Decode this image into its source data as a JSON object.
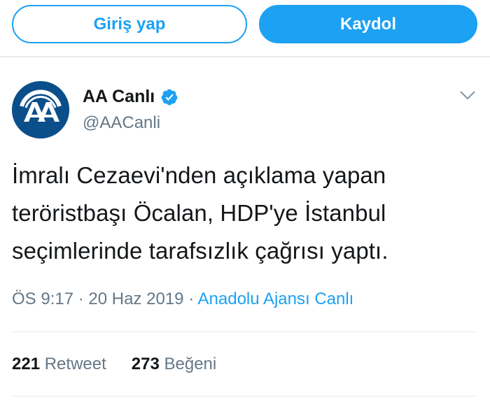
{
  "auth": {
    "login_label": "Giriş yap",
    "signup_label": "Kaydol"
  },
  "tweet": {
    "avatar_icon": "aa-logo-icon",
    "display_name": "AA Canlı",
    "verified_icon": "verified-badge-icon",
    "handle": "@AACanli",
    "menu_icon": "chevron-down-icon",
    "text_lines": [
      "İmralı Cezaevi'nden açıklama yapan",
      "teröristbaşı Öcalan, HDP'ye İstanbul",
      "seçimlerinde tarafsızlık çağrısı yaptı."
    ],
    "time": "ÖS 9:17",
    "sep": "·",
    "date": "20 Haz 2019",
    "source": "Anadolu Ajansı Canlı",
    "retweet_count": "221",
    "retweet_label": "Retweet",
    "like_count": "273",
    "like_label": "Beğeni"
  },
  "colors": {
    "accent": "#1da1f2",
    "avatar_bg": "#0b4f8a",
    "muted": "#657786",
    "divider": "#e6ecf0"
  }
}
